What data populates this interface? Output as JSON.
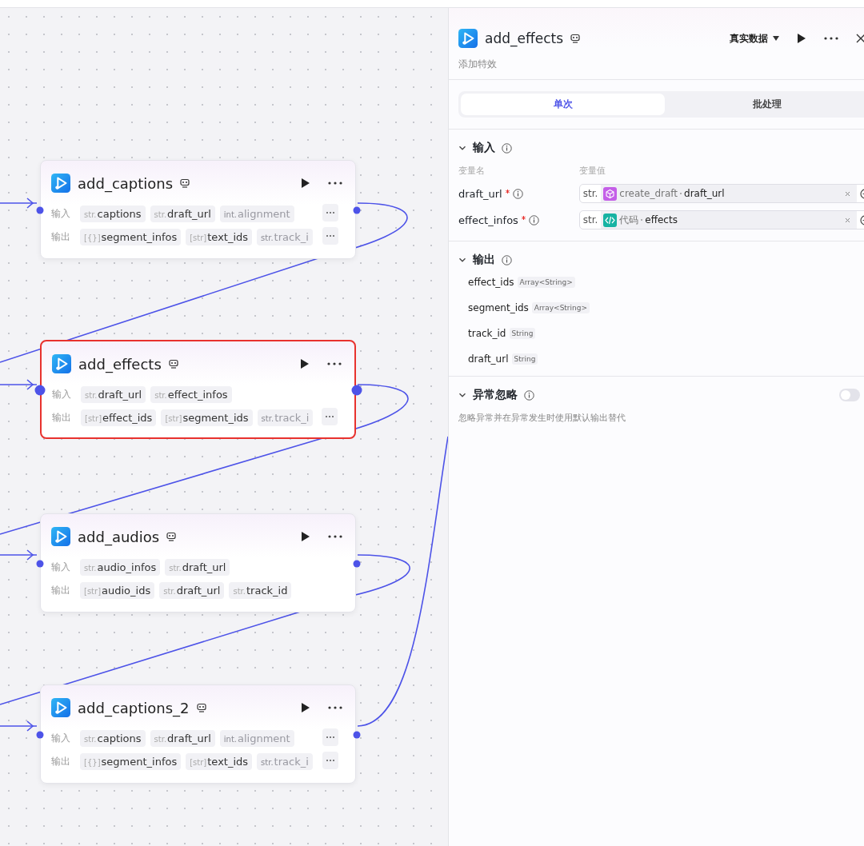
{
  "canvas": {
    "nodes": [
      {
        "title": "add_captions",
        "selected": false,
        "rows": [
          {
            "label": "输入",
            "overflow": true,
            "chips": [
              {
                "type": "str.",
                "name": "captions",
                "faded": false
              },
              {
                "type": "str.",
                "name": "draft_url",
                "faded": false
              },
              {
                "type": "int.",
                "name": "alignment",
                "faded": true
              }
            ]
          },
          {
            "label": "输出",
            "overflow": true,
            "chips": [
              {
                "type": "[{}]",
                "name": "segment_infos",
                "faded": false
              },
              {
                "type": "[str]",
                "name": "text_ids",
                "faded": false
              },
              {
                "type": "str.",
                "name": "track_i",
                "faded": true
              }
            ]
          }
        ]
      },
      {
        "title": "add_effects",
        "selected": true,
        "rows": [
          {
            "label": "输入",
            "overflow": false,
            "chips": [
              {
                "type": "str.",
                "name": "draft_url",
                "faded": false
              },
              {
                "type": "str.",
                "name": "effect_infos",
                "faded": false
              }
            ]
          },
          {
            "label": "输出",
            "overflow": true,
            "chips": [
              {
                "type": "[str]",
                "name": "effect_ids",
                "faded": false
              },
              {
                "type": "[str]",
                "name": "segment_ids",
                "faded": false
              },
              {
                "type": "str.",
                "name": "track_i",
                "faded": true
              }
            ]
          }
        ]
      },
      {
        "title": "add_audios",
        "selected": false,
        "rows": [
          {
            "label": "输入",
            "overflow": false,
            "chips": [
              {
                "type": "str.",
                "name": "audio_infos",
                "faded": false
              },
              {
                "type": "str.",
                "name": "draft_url",
                "faded": false
              }
            ]
          },
          {
            "label": "输出",
            "overflow": false,
            "chips": [
              {
                "type": "[str]",
                "name": "audio_ids",
                "faded": false
              },
              {
                "type": "str.",
                "name": "draft_url",
                "faded": false
              },
              {
                "type": "str.",
                "name": "track_id",
                "faded": false
              }
            ]
          }
        ]
      },
      {
        "title": "add_captions_2",
        "selected": false,
        "rows": [
          {
            "label": "输入",
            "overflow": true,
            "chips": [
              {
                "type": "str.",
                "name": "captions",
                "faded": false
              },
              {
                "type": "str.",
                "name": "draft_url",
                "faded": false
              },
              {
                "type": "int.",
                "name": "alignment",
                "faded": true
              }
            ]
          },
          {
            "label": "输出",
            "overflow": true,
            "chips": [
              {
                "type": "[{}]",
                "name": "segment_infos",
                "faded": false
              },
              {
                "type": "[str]",
                "name": "text_ids",
                "faded": false
              },
              {
                "type": "str.",
                "name": "track_i",
                "faded": true
              }
            ]
          }
        ]
      }
    ]
  },
  "panel": {
    "title": "add_effects",
    "subtitle": "添加特效",
    "data_mode": "真实数据",
    "tabs": [
      {
        "label": "单次",
        "selected": true
      },
      {
        "label": "批处理",
        "selected": false
      }
    ],
    "input": {
      "title": "输入",
      "expanded": true,
      "name_header": "变量名",
      "value_header": "变量值",
      "params": [
        {
          "name": "draft_url",
          "required": true,
          "type": "str.",
          "kind": "plugin",
          "source": "create_draft",
          "value": "draft_url"
        },
        {
          "name": "effect_infos",
          "required": true,
          "type": "str.",
          "kind": "code",
          "source": "代码",
          "value": "effects"
        }
      ]
    },
    "output": {
      "title": "输出",
      "expanded": true,
      "fields": [
        {
          "name": "effect_ids",
          "type": "Array<String>"
        },
        {
          "name": "segment_ids",
          "type": "Array<String>"
        },
        {
          "name": "track_id",
          "type": "String"
        },
        {
          "name": "draft_url",
          "type": "String"
        }
      ]
    },
    "exception": {
      "title": "异常忽略",
      "expanded": true,
      "on": false,
      "description": "忽略异常并在异常发生时使用默认输出替代"
    }
  }
}
